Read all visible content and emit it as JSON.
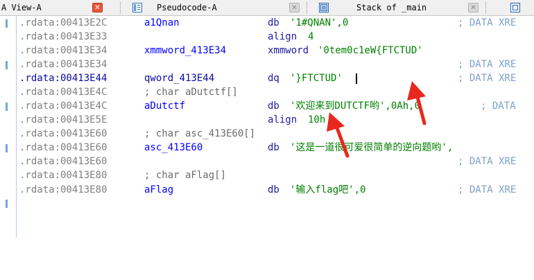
{
  "tabs": [
    {
      "label": "A View-A",
      "icon": "ida-view-icon",
      "close_style": "active"
    },
    {
      "label": "Pseudocode-A",
      "icon": "pseudocode-icon",
      "close_style": "inactive"
    },
    {
      "label": "Stack of _main",
      "icon": "stack-icon",
      "close_style": "inactive"
    }
  ],
  "colors": {
    "address_gray": "#7f7f7f",
    "name_blue": "#0000ff",
    "string_green": "#008000",
    "xref_blue": "#7fa0c8",
    "annotation_red": "#e8281e"
  },
  "listing": {
    "lines": [
      {
        "addr": ".rdata:00413E2C",
        "name": "a1Qnan",
        "op": "db",
        "operand": "'1#QNAN',0",
        "comment": "; DATA XRE"
      },
      {
        "addr": ".rdata:00413E33",
        "name": "",
        "op": "align",
        "operand": "4",
        "comment": ""
      },
      {
        "addr": ".rdata:00413E34",
        "name": "xmmword_413E34",
        "op": "xmmword",
        "operand": "'0tem0c1eW{FTCTUD'",
        "comment": ""
      },
      {
        "addr": ".rdata:00413E34",
        "name": "",
        "op": "",
        "operand": "",
        "comment": "; DATA XRE"
      },
      {
        "addr": ".rdata:00413E44",
        "name": "qword_413E44",
        "op": "dq",
        "operand": "'}FTCTUD'",
        "comment": "; DATA XRE"
      },
      {
        "addr": ".rdata:00413E4C",
        "name": "; char aDutctf[]",
        "op": "",
        "operand": "",
        "comment": ""
      },
      {
        "addr": ".rdata:00413E4C",
        "name": "aDutctf",
        "op": "db",
        "operand": "'欢迎来到DUTCTF哟',0Ah,0",
        "comment": "; DATA"
      },
      {
        "addr": ".rdata:00413E5E",
        "name": "",
        "op": "align",
        "operand": "10h",
        "comment": ""
      },
      {
        "addr": ".rdata:00413E60",
        "name": "; char asc_413E60[]",
        "op": "",
        "operand": "",
        "comment": ""
      },
      {
        "addr": ".rdata:00413E60",
        "name": "asc_413E60",
        "op": "db",
        "operand": "'这是一道很可爱很简单的逆向题哟',",
        "comment": ""
      },
      {
        "addr": ".rdata:00413E60",
        "name": "",
        "op": "",
        "operand": "",
        "comment": "; DATA XRE"
      },
      {
        "addr": ".rdata:00413E80",
        "name": "; char aFlag[]",
        "op": "",
        "operand": "",
        "comment": ""
      },
      {
        "addr": ".rdata:00413E80",
        "name": "aFlag",
        "op": "db",
        "operand": "'输入flag吧',0",
        "comment": "; DATA XRE"
      }
    ]
  }
}
